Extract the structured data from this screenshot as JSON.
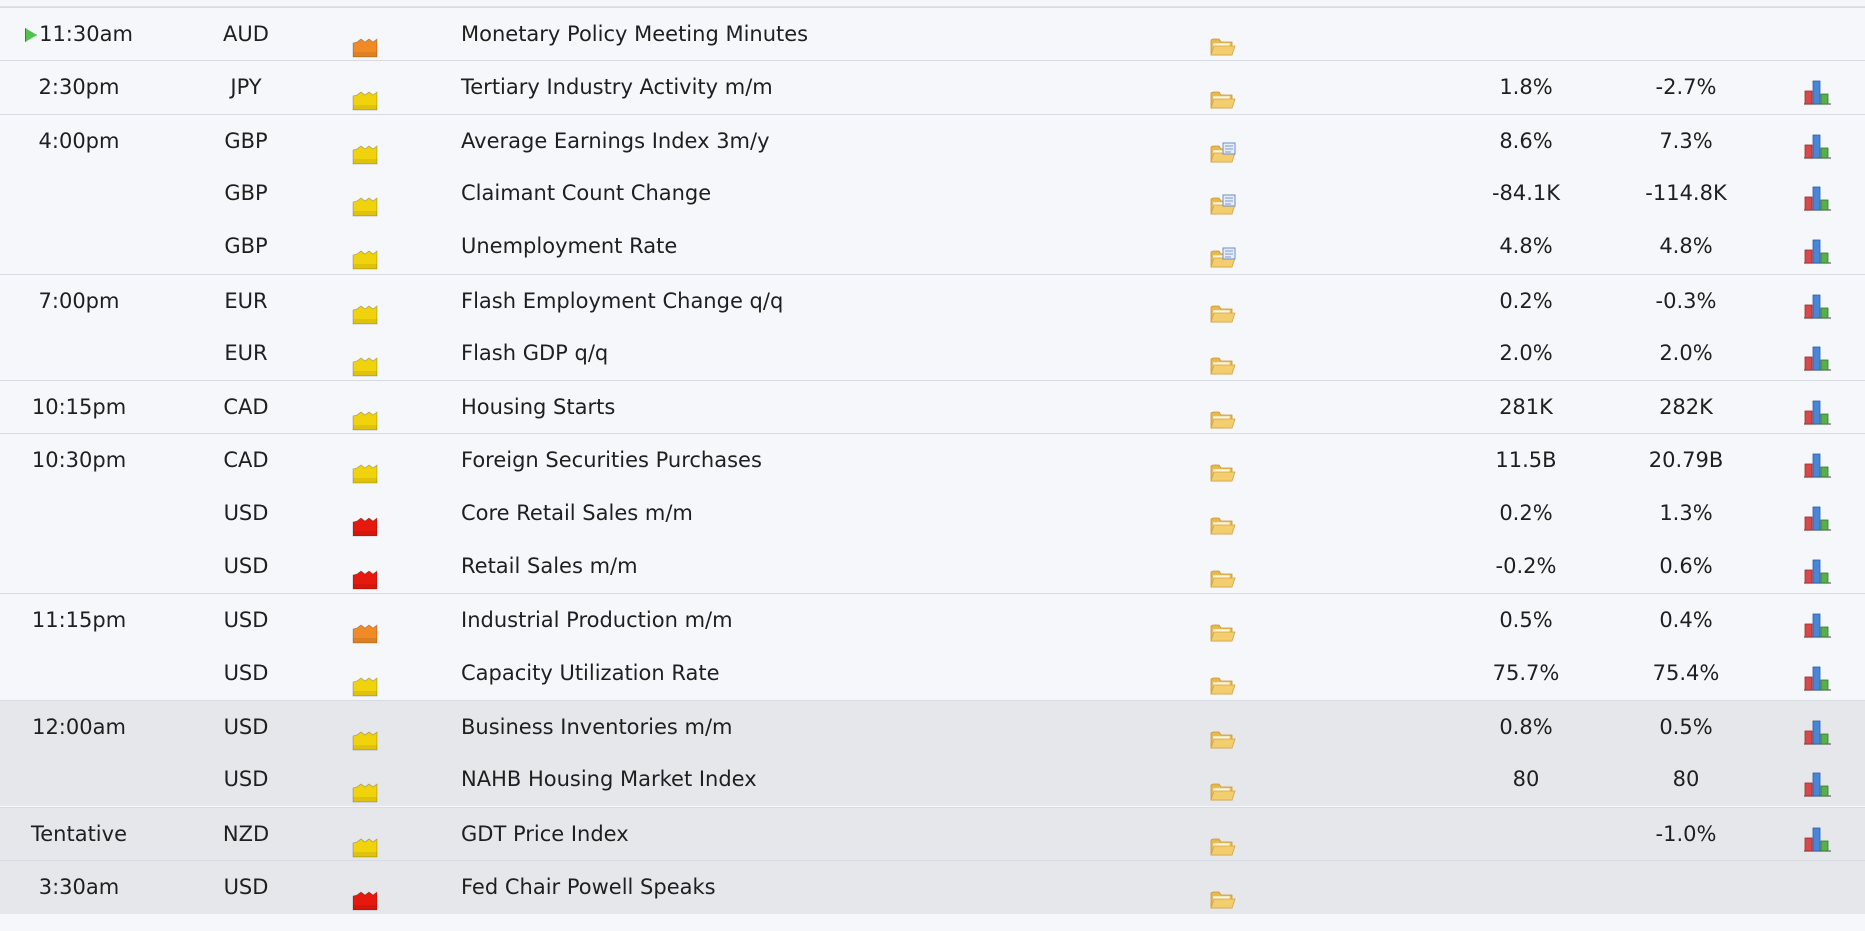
{
  "colors": {
    "low": "#f1d30d",
    "medium": "#f08a27",
    "high": "#e6190f",
    "folder": "#f4ce6e",
    "row_gray": "#e6e7eb"
  },
  "icons": {
    "impact": "impact-folder-icon",
    "detail": "detail-folder-icon",
    "detail_revised": "detail-folder-revised-icon",
    "chart": "bar-chart-icon",
    "current": "play-icon"
  },
  "rows": [
    {
      "time": "11:30am",
      "currency": "AUD",
      "impact": "medium",
      "event": "Monetary Policy Meeting Minutes",
      "actual": "",
      "forecast": "",
      "chart": false,
      "detail": "normal",
      "sep": true,
      "gray": false,
      "current": true
    },
    {
      "time": "2:30pm",
      "currency": "JPY",
      "impact": "low",
      "event": "Tertiary Industry Activity m/m",
      "actual": "1.8%",
      "forecast": "-2.7%",
      "chart": true,
      "detail": "normal",
      "sep": true,
      "gray": false,
      "current": false
    },
    {
      "time": "4:00pm",
      "currency": "GBP",
      "impact": "low",
      "event": "Average Earnings Index 3m/y",
      "actual": "8.6%",
      "forecast": "7.3%",
      "chart": true,
      "detail": "revised",
      "sep": true,
      "gray": false,
      "current": false
    },
    {
      "time": "",
      "currency": "GBP",
      "impact": "low",
      "event": "Claimant Count Change",
      "actual": "-84.1K",
      "forecast": "-114.8K",
      "chart": true,
      "detail": "revised",
      "sep": false,
      "gray": false,
      "current": false
    },
    {
      "time": "",
      "currency": "GBP",
      "impact": "low",
      "event": "Unemployment Rate",
      "actual": "4.8%",
      "forecast": "4.8%",
      "chart": true,
      "detail": "revised",
      "sep": false,
      "gray": false,
      "current": false
    },
    {
      "time": "7:00pm",
      "currency": "EUR",
      "impact": "low",
      "event": "Flash Employment Change q/q",
      "actual": "0.2%",
      "forecast": "-0.3%",
      "chart": true,
      "detail": "normal",
      "sep": true,
      "gray": false,
      "current": false
    },
    {
      "time": "",
      "currency": "EUR",
      "impact": "low",
      "event": "Flash GDP q/q",
      "actual": "2.0%",
      "forecast": "2.0%",
      "chart": true,
      "detail": "normal",
      "sep": false,
      "gray": false,
      "current": false
    },
    {
      "time": "10:15pm",
      "currency": "CAD",
      "impact": "low",
      "event": "Housing Starts",
      "actual": "281K",
      "forecast": "282K",
      "chart": true,
      "detail": "normal",
      "sep": true,
      "gray": false,
      "current": false
    },
    {
      "time": "10:30pm",
      "currency": "CAD",
      "impact": "low",
      "event": "Foreign Securities Purchases",
      "actual": "11.5B",
      "forecast": "20.79B",
      "chart": true,
      "detail": "normal",
      "sep": true,
      "gray": false,
      "current": false
    },
    {
      "time": "",
      "currency": "USD",
      "impact": "high",
      "event": "Core Retail Sales m/m",
      "actual": "0.2%",
      "forecast": "1.3%",
      "chart": true,
      "detail": "normal",
      "sep": false,
      "gray": false,
      "current": false
    },
    {
      "time": "",
      "currency": "USD",
      "impact": "high",
      "event": "Retail Sales m/m",
      "actual": "-0.2%",
      "forecast": "0.6%",
      "chart": true,
      "detail": "normal",
      "sep": false,
      "gray": false,
      "current": false
    },
    {
      "time": "11:15pm",
      "currency": "USD",
      "impact": "medium",
      "event": "Industrial Production m/m",
      "actual": "0.5%",
      "forecast": "0.4%",
      "chart": true,
      "detail": "normal",
      "sep": true,
      "gray": false,
      "current": false
    },
    {
      "time": "",
      "currency": "USD",
      "impact": "low",
      "event": "Capacity Utilization Rate",
      "actual": "75.7%",
      "forecast": "75.4%",
      "chart": true,
      "detail": "normal",
      "sep": false,
      "gray": false,
      "current": false
    },
    {
      "time": "12:00am",
      "currency": "USD",
      "impact": "low",
      "event": "Business Inventories m/m",
      "actual": "0.8%",
      "forecast": "0.5%",
      "chart": true,
      "detail": "normal",
      "sep": true,
      "gray": true,
      "current": false
    },
    {
      "time": "",
      "currency": "USD",
      "impact": "low",
      "event": "NAHB Housing Market Index",
      "actual": "80",
      "forecast": "80",
      "chart": true,
      "detail": "normal",
      "sep": false,
      "gray": true,
      "current": false
    },
    {
      "time": "Tentative",
      "currency": "NZD",
      "impact": "low",
      "event": "GDT Price Index",
      "actual": "",
      "forecast": "-1.0%",
      "chart": true,
      "detail": "normal",
      "sep": true,
      "gray": true,
      "current": false
    },
    {
      "time": "3:30am",
      "currency": "USD",
      "impact": "high",
      "event": "Fed Chair Powell Speaks",
      "actual": "",
      "forecast": "",
      "chart": false,
      "detail": "normal",
      "sep": true,
      "gray": true,
      "current": false
    }
  ]
}
